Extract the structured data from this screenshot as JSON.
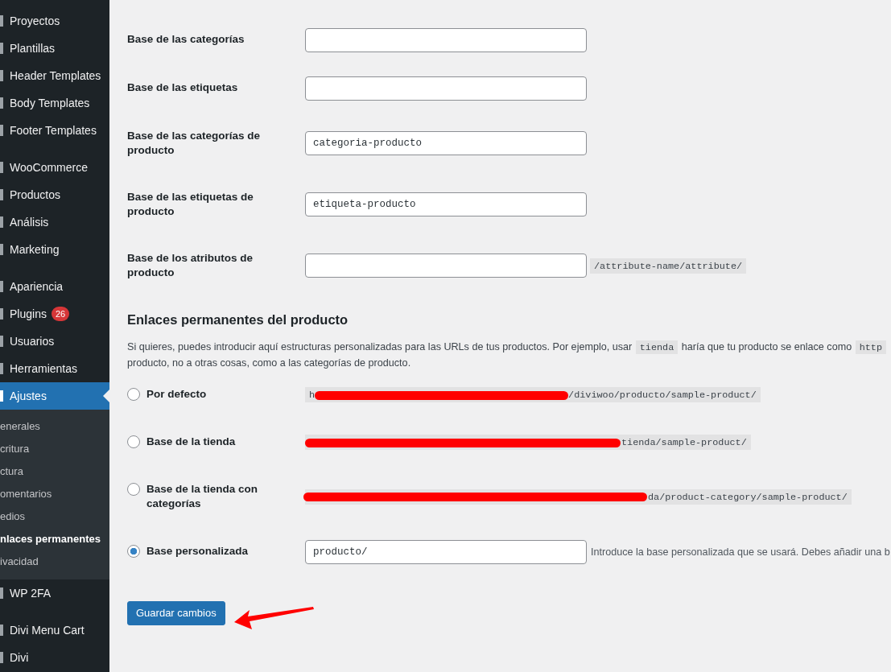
{
  "sidebar": {
    "groups": [
      {
        "items": [
          {
            "label": "Proyectos",
            "selected": false
          },
          {
            "label": "Plantillas",
            "selected": false
          },
          {
            "label": "Header Templates",
            "selected": false
          },
          {
            "label": "Body Templates",
            "selected": false
          },
          {
            "label": "Footer Templates",
            "selected": false
          }
        ]
      },
      {
        "items": [
          {
            "label": "WooCommerce",
            "selected": false
          },
          {
            "label": "Productos",
            "selected": false
          },
          {
            "label": "Análisis",
            "selected": false
          },
          {
            "label": "Marketing",
            "selected": false
          }
        ]
      },
      {
        "items": [
          {
            "label": "Apariencia",
            "selected": false
          },
          {
            "label": "Plugins",
            "selected": false,
            "badge": "26"
          },
          {
            "label": "Usuarios",
            "selected": false
          },
          {
            "label": "Herramientas",
            "selected": false
          },
          {
            "label": "Ajustes",
            "selected": true,
            "children": [
              {
                "label": "enerales",
                "selected": false
              },
              {
                "label": "critura",
                "selected": false
              },
              {
                "label": "ctura",
                "selected": false
              },
              {
                "label": "omentarios",
                "selected": false
              },
              {
                "label": "edios",
                "selected": false
              },
              {
                "label": "nlaces permanentes",
                "selected": true
              },
              {
                "label": "ivacidad",
                "selected": false
              }
            ]
          },
          {
            "label": "WP 2FA",
            "selected": false
          }
        ]
      },
      {
        "items": [
          {
            "label": "Divi Menu Cart",
            "selected": false
          },
          {
            "label": "Divi",
            "selected": false
          }
        ]
      }
    ]
  },
  "base_fields": [
    {
      "label": "Base de las categorías"
    },
    {
      "label": "Base de las etiquetas"
    },
    {
      "label": "Base de las categorías de producto",
      "value": "categoria-producto"
    },
    {
      "label": "Base de las etiquetas de producto",
      "value": "etiqueta-producto"
    },
    {
      "label": "Base de los atributos de producto",
      "example": "/attribute-name/attribute/"
    }
  ],
  "product_permalinks": {
    "heading": "Enlaces permanentes del producto",
    "description_lines": [
      [
        {
          "kind": "text",
          "text": "Si quieres, puedes introducir aquí estructuras personalizadas para las URLs de tus productos. Por ejemplo, usar"
        },
        {
          "kind": "code",
          "text": "tienda"
        },
        {
          "kind": "text",
          "text": "haría que tu producto se enlace como"
        },
        {
          "kind": "code",
          "text": "http"
        }
      ],
      [
        {
          "kind": "text",
          "text": "producto, no a otras cosas, como a las categorías de producto."
        }
      ]
    ],
    "options": [
      {
        "kind": "url",
        "label": "Por defecto",
        "selected": false,
        "url_start": "h",
        "url_end": "/diviwoo/producto/sample-product/"
      },
      {
        "kind": "url",
        "label": "Base de la tienda",
        "selected": false,
        "url_end": "tienda/sample-product/"
      },
      {
        "kind": "url",
        "label": "Base de la tienda con categorías",
        "selected": false,
        "url_end": "da/product-category/sample-product/"
      },
      {
        "kind": "custom",
        "label": "Base personalizada",
        "selected": true,
        "value": "producto/",
        "hint": "Introduce la base personalizada que se usará. Debes añadir una b"
      }
    ]
  },
  "save_button": "Guardar cambios"
}
